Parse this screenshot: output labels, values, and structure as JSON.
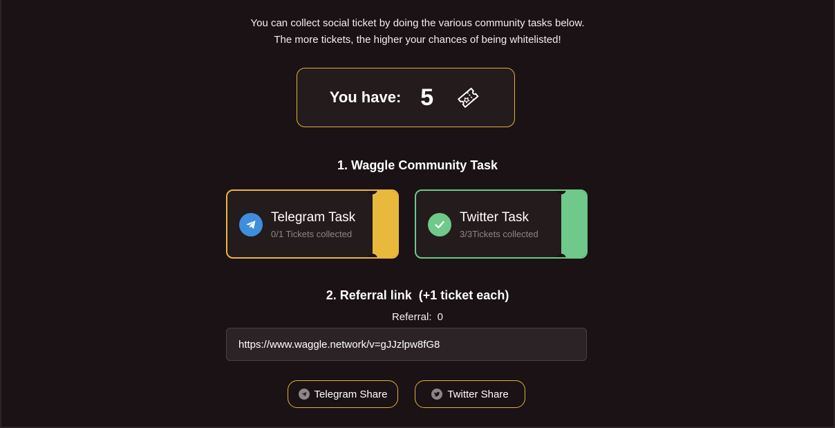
{
  "intro": {
    "line1": "You can collect social ticket by doing the various community tasks below.",
    "line2": "The more tickets, the higher your chances of being whitelisted!"
  },
  "ticket_count": {
    "label": "You have:",
    "value": "5",
    "icon": "ticket-icon"
  },
  "section1": {
    "title": "1. Waggle Community Task",
    "tasks": [
      {
        "name": "Telegram Task",
        "status": "0/1 Tickets collected",
        "icon": "telegram-icon",
        "accent": "#e8b93c"
      },
      {
        "name": "Twitter Task",
        "status": "3/3Tickets collected",
        "icon": "check-icon",
        "accent": "#6fc98a"
      }
    ]
  },
  "section2": {
    "title": "2. Referral link  (+1 ticket each)",
    "referral_label": "Referral:",
    "referral_value": "0",
    "link": "https://www.waggle.network/v=gJJzlpw8fG8"
  },
  "share": {
    "telegram_label": "Telegram Share",
    "twitter_label": "Twitter Share"
  },
  "colors": {
    "background": "#1a1214",
    "gold_accent": "#e2b23f",
    "green_accent": "#6fc98a",
    "telegram_blue": "#3d8fdc"
  }
}
